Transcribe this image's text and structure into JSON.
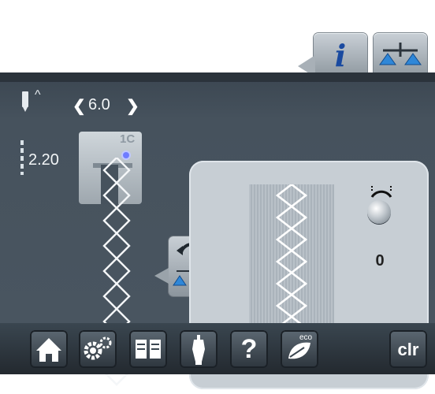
{
  "top": {
    "info_icon": "info-icon",
    "info_glyph": "i",
    "balance_icon": "balance-icon"
  },
  "panel": {
    "needle_icon": "needle-position-icon",
    "needle_arrow": "^",
    "stitch_width": {
      "left": "❮",
      "value": "6.0",
      "right": "❯"
    },
    "stitch_length": "2.20",
    "presser_foot": "1C",
    "balance": {
      "icon": "balance-knob-icon",
      "value": "0"
    }
  },
  "bottom_bar": {
    "home": "home-icon",
    "setup": "setup-icon",
    "tutorial": "tutorial-icon",
    "advisor": "sewing-advisor-icon",
    "help": "?",
    "eco": "eco",
    "clr": "clr"
  },
  "colors": {
    "panel_bg": "#46525d",
    "preview_bg": "#c7ced4",
    "accent_blue": "#1a4aa0"
  }
}
